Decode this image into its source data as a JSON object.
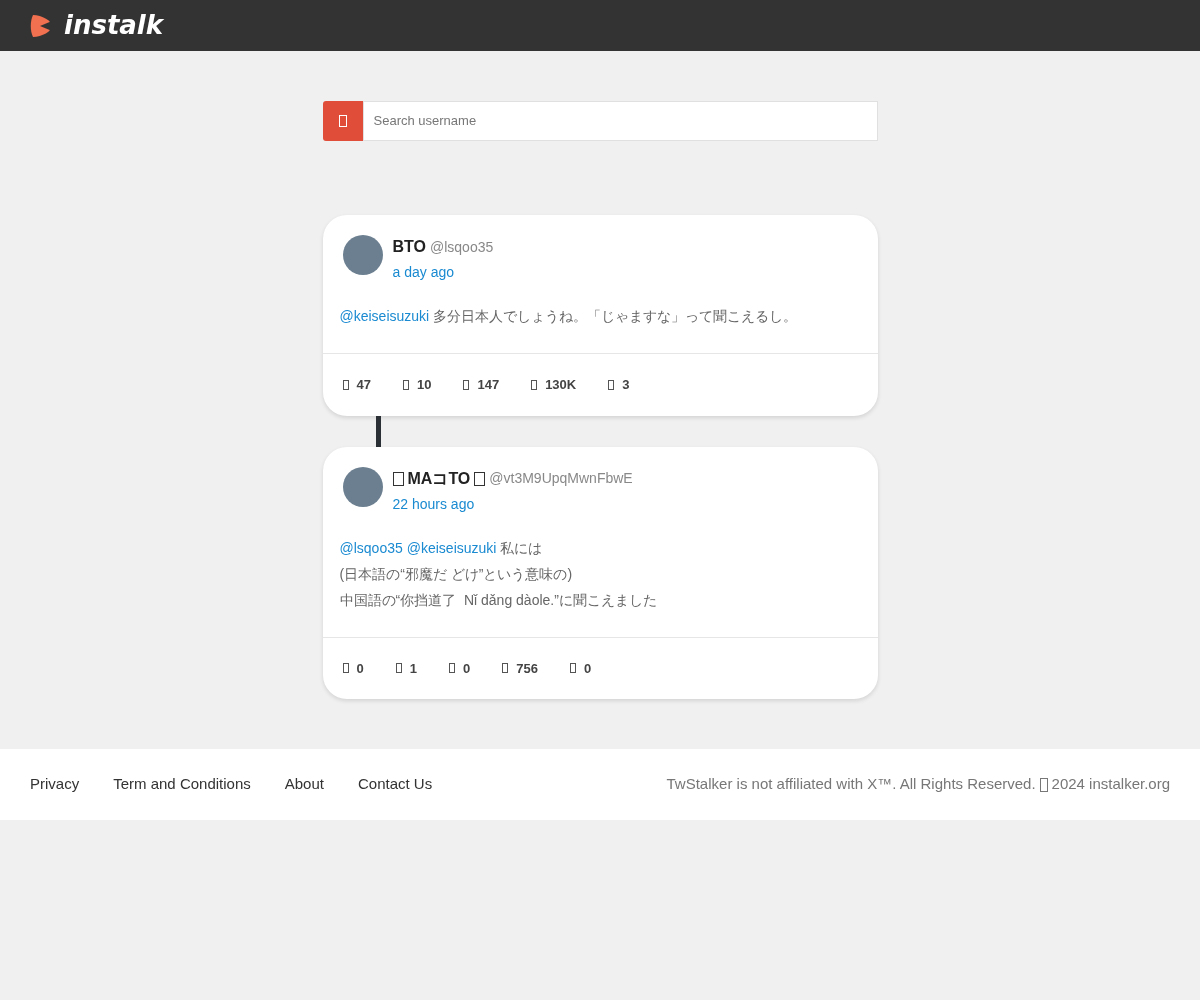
{
  "header": {
    "logo_text": "instalk"
  },
  "search": {
    "placeholder": "Search username"
  },
  "tweets": [
    {
      "name": "BTO",
      "name_glyphs": false,
      "handle": "@lsqoo35",
      "time": "a day ago",
      "lines": [
        [
          {
            "kind": "mention",
            "text": "@keiseisuzuki"
          },
          {
            "kind": "text",
            "text": "多分日本人でしょうね。「じゃますな」って聞こえるし。"
          }
        ]
      ],
      "stats": [
        "47",
        "10",
        "147",
        "130K",
        "3"
      ]
    },
    {
      "name": "MAコTO",
      "name_glyphs": true,
      "handle": "@vt3M9UpqMwnFbwE",
      "time": "22 hours ago",
      "lines": [
        [
          {
            "kind": "mention",
            "text": "@lsqoo35"
          },
          {
            "kind": "mention",
            "text": "@keiseisuzuki"
          },
          {
            "kind": "text",
            "text": "私には"
          }
        ],
        [
          {
            "kind": "text",
            "text": "(日本語の“邪魔だ どけ”という意味の)"
          }
        ],
        [
          {
            "kind": "text",
            "text": "中国語の“你挡道了  Nǐ dǎng dàole.”に聞こえました"
          }
        ]
      ],
      "stats": [
        "0",
        "1",
        "0",
        "756",
        "0"
      ]
    }
  ],
  "footer": {
    "links": [
      "Privacy",
      "Term and Conditions",
      "About",
      "Contact Us"
    ],
    "notice_before": "TwStalker is not affiliated with X™. All Rights Reserved.",
    "notice_after": "2024 instalker.org"
  }
}
